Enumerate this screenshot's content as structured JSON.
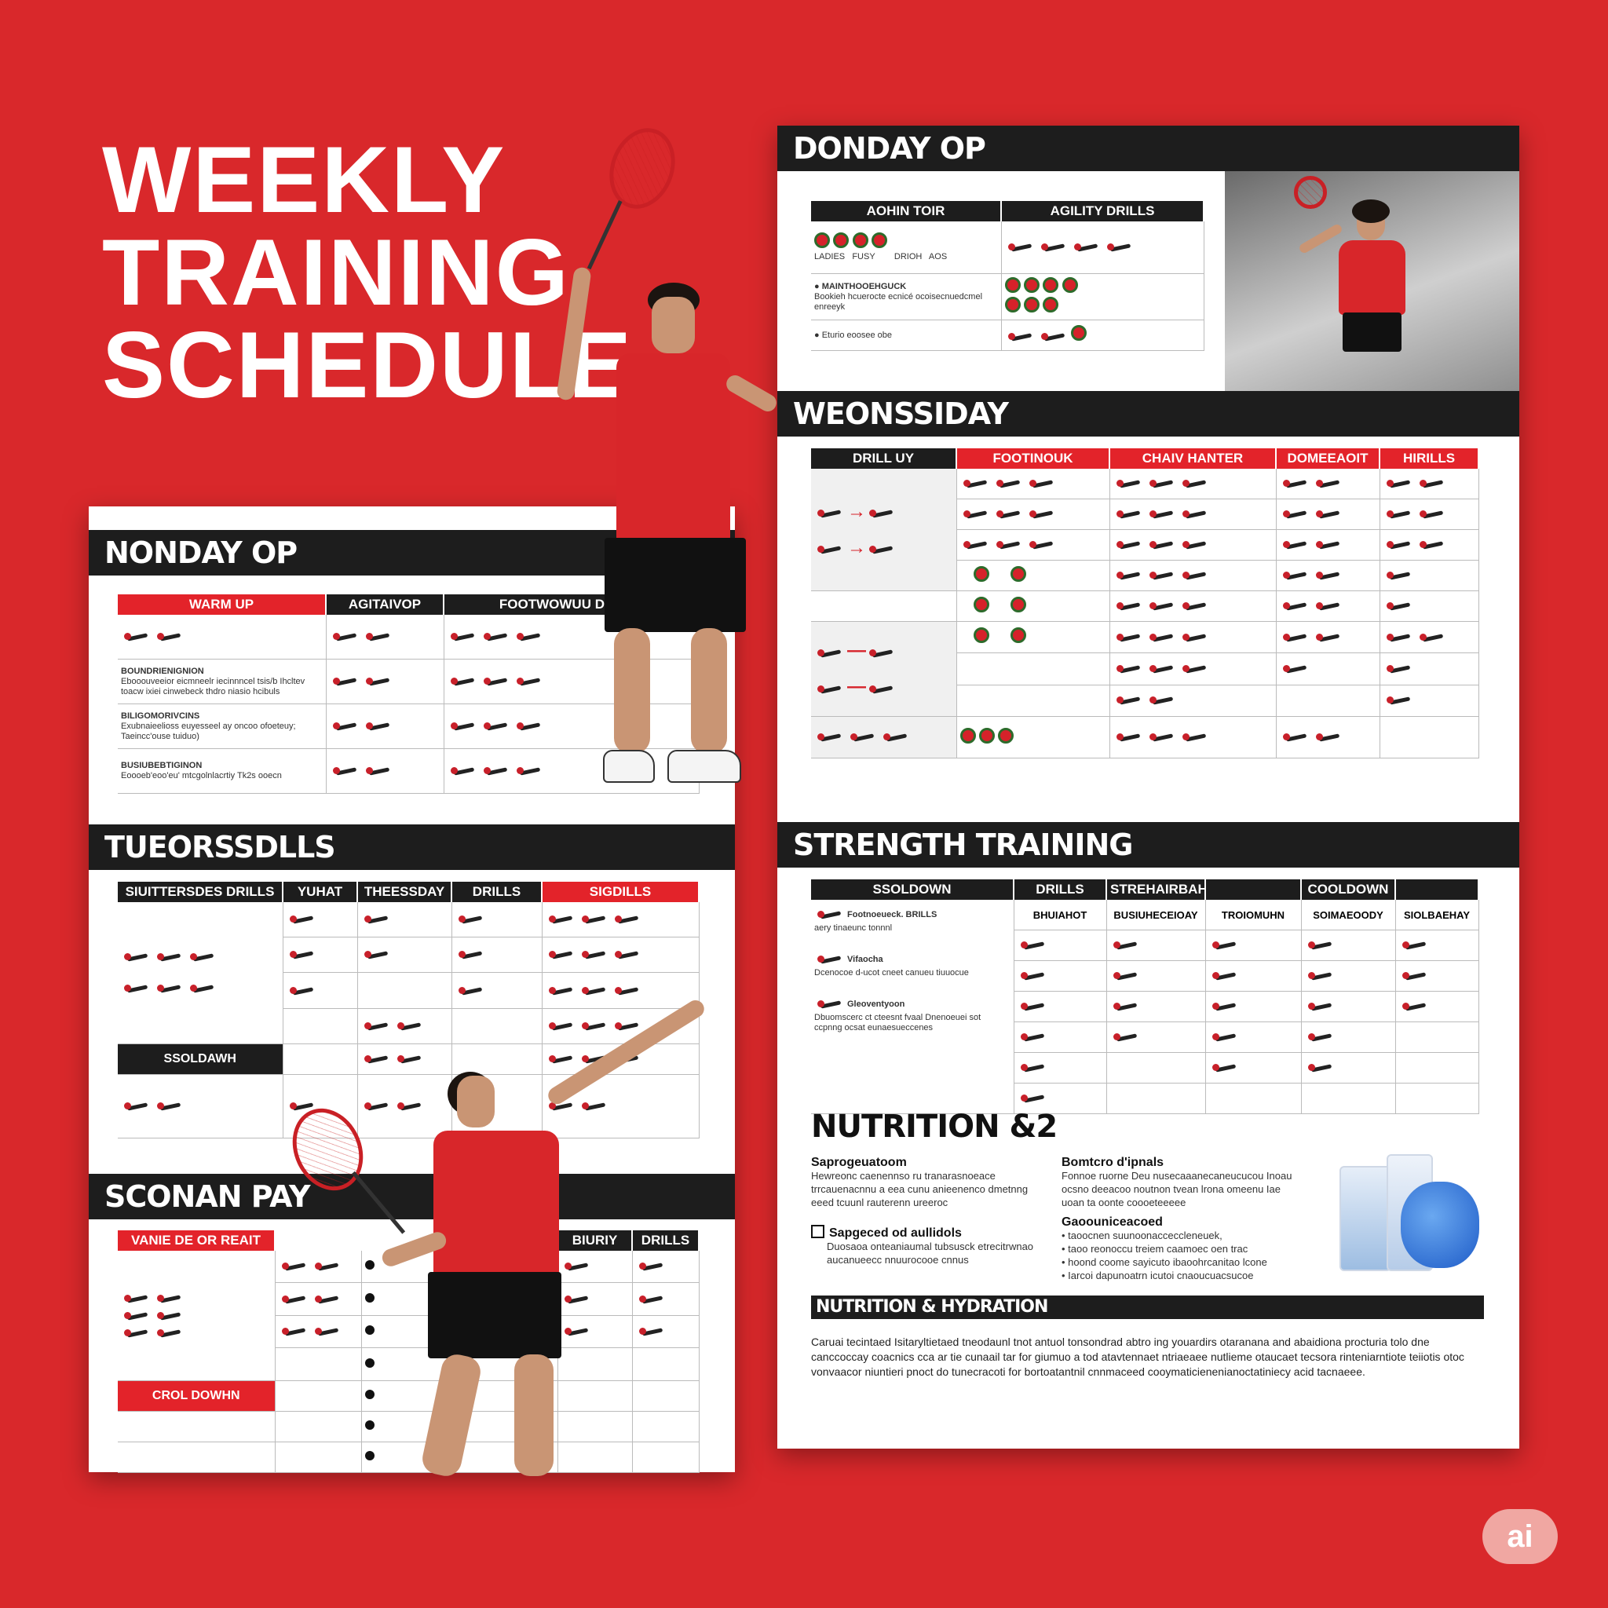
{
  "title": [
    "WEEKLY",
    "TRAINING",
    "SCHEDULE"
  ],
  "left_card": {
    "monday": {
      "heading": "NONDAY OP",
      "columns": [
        "WARM UP",
        "AGITAIVOP",
        "FOOTWOWUU DRILLS"
      ],
      "items": [
        {
          "title": "BOUNDRIENIGNION",
          "text": "Ebooouveeior eicmneelr iecinnncel tsis/b Ihcltev toacw ixiei cinwebeck thdro niasio hcibuls"
        },
        {
          "title": "BILIGOMORIVCINS",
          "text": "Exubnaieelioss euyesseel ay oncoo ofoeteuy; Taeincc'ouse tuiduo)"
        },
        {
          "title": "BUSIUBEBTIGINON",
          "text": "Eoooeb'eoo'eu' mtcgolnlacrtiy Tk2s ooecn"
        }
      ]
    },
    "tuesday": {
      "heading": "TUEORSSDLLS",
      "columns": [
        "SIUITTERSDES DRILLS",
        "YUHAT",
        "THEESSDAY",
        "DRILLS",
        "SIGDILLS"
      ],
      "sublabel": "SSOLDAWH"
    },
    "saturday": {
      "heading": "SCONAN PAY",
      "columns": [
        "VANIE DE OR REAIT",
        "",
        "",
        "BIURIY",
        "DRILLS"
      ],
      "sublabel": "CROL DOWHN"
    }
  },
  "right_card": {
    "monday": {
      "heading": "DONDAY OP",
      "columns": [
        "AOHIN TOIR",
        "AGILITY DRILLS"
      ],
      "axis_labels": [
        "LADIES",
        "FUSY",
        "DRIOH",
        "AOS"
      ],
      "items": [
        {
          "title": "MAINTHOOEHGUCK",
          "text": "Bookieh hcuerocte ecnicé ocoisecnuedcmel enreeyk"
        },
        {
          "title": "",
          "text": "Eturio eoosee obe"
        }
      ]
    },
    "wednesday": {
      "heading": "WEONSSIDAY",
      "columns": [
        "DRILL UY",
        "FOOTINOUK",
        "CHAIV  HANTER",
        "DOMEEAOIT",
        "HIRILLS"
      ]
    },
    "strength": {
      "heading": "STRENGTH TRAINING",
      "top_columns": [
        "SSOLDOWN",
        "DRILLS",
        "STREHAIRBAH",
        "",
        "COOLDOWN",
        ""
      ],
      "sub_columns": [
        "BHUIAHOT",
        "BUSIUHECEIOAY",
        "TROIOMUHN",
        "SOIMAEOODY",
        "SIOLBAEHAY"
      ],
      "items": [
        {
          "title": "Footnoeueck. BRILLS",
          "text": "aery tinaeunc tonnnl"
        },
        {
          "title": "Vifaocha",
          "text": "Dcenocoe d-ucot cneet canueu tiuuocue"
        },
        {
          "title": "Gleoventyoon",
          "text": "Dbuomscerc ct cteesnt fvaal Dnenoeuei sot ccpnng ocsat eunaesueccenes"
        }
      ]
    },
    "nutrition": {
      "heading": "NUTRITION &2",
      "col1_title": "Saprogeuatoom",
      "col1_text": "Hewreonc caenennso ru tranarasnoeace trrcauenacnnu a eea cunu anieenenco dmetnng eeed tcuunl rauterenn ureeroc",
      "col2_title": "Bomtcro d'ipnals",
      "col2_text": "Fonnoe ruorne Deu nusecaaanecaneucucou Inoau ocsno deeacoo noutnon tvean lrona omeenu Iae uoan ta oonte coooeteeeee",
      "checkbox_title": "Sapgeced od aullidols",
      "checkbox_text": "Duosaoa onteaniaumal tubsusck etrecitrwnao aucanueecc nnuurocooe cnnus",
      "col3_title": "Gaoouniceacoed",
      "col3_lines": [
        "taoocnen suunoonacceccleneuek,",
        "taoo reonoccu treiem caamoec oen trac",
        "hoond coome sayicuto ibaoohrcanitao lcone",
        "Iarcoi dapunoatrn icutoi cnaoucuacsucoe"
      ],
      "bar_heading": "NUTRITION & HYDRATION",
      "paragraph": "Caruai tecintaed Isitaryltietaed tneodaunl tnot antuol tonsondrad abtro ing youardirs otaranana and abaidiona procturia tolo dne canccoccay coacnics cca ar tie cunaail tar for giumuo a tod atavtennaet ntriaeaee nutlieme otaucaet tecsora rinteniarntiote teiiotis otoc vonvaacor niuntieri pnoct do tunecracoti for bortoatantnil cnnmaceed cooymaticienenianoctatiniecy acid tacnaeee."
    }
  },
  "badge": "ai",
  "colors": {
    "brand_red": "#d9282b",
    "header_black": "#1d1d1d",
    "accent_red": "#e3232a"
  }
}
